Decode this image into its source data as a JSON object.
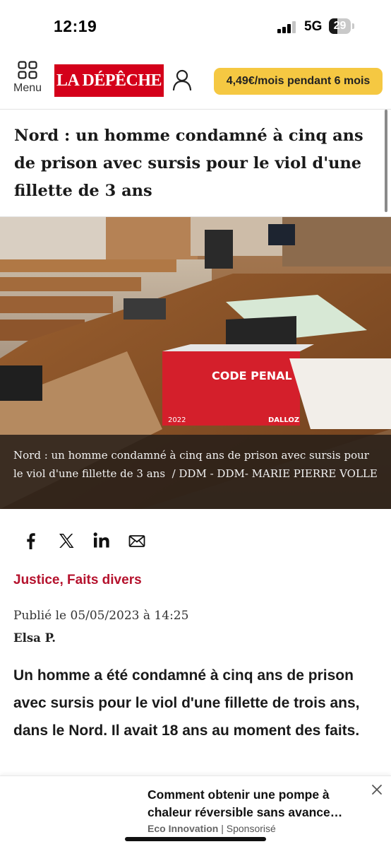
{
  "status": {
    "time": "12:19",
    "network": "5G",
    "battery": "29"
  },
  "header": {
    "menu_label": "Menu",
    "logo_text": "LA DÉPÊCHE",
    "subscribe_label": "4,49€/mois pendant 6 mois",
    "icons": [
      "menu-grid-icon",
      "user-icon"
    ],
    "colors": {
      "brand": "#d4001a",
      "subscribe": "#f5c842"
    }
  },
  "article": {
    "title": "Nord : un homme condamné à cinq ans de prison avec sursis pour le viol d'une fillette de 3 ans",
    "image_caption": "Nord : un homme condamné à cinq ans de prison avec sursis pour le viol d'une fillette de 3 ans",
    "image_credit": "DDM - DDM- MARIE PIERRE VOLLE",
    "categories": [
      "Justice",
      "Faits divers"
    ],
    "published": "Publié le 05/05/2023 à 14:25",
    "author": "Elsa P.",
    "lead": "Un homme a été condamné à cinq ans de prison avec sursis pour le viol d'une fillette de trois ans, dans le Nord. Il avait 18 ans au moment des faits.",
    "image_book_label": "CODE PENAL",
    "image_book_year": "2022",
    "image_book_brand": "DALLOZ"
  },
  "share": {
    "icons": [
      "facebook-icon",
      "x-icon",
      "linkedin-icon",
      "email-icon"
    ]
  },
  "ad": {
    "title": "Comment obtenir une pompe à chaleur réversible sans avance…",
    "source": "Eco Innovation",
    "sponsored": "Sponsorisé",
    "close_icon": "close-icon"
  }
}
